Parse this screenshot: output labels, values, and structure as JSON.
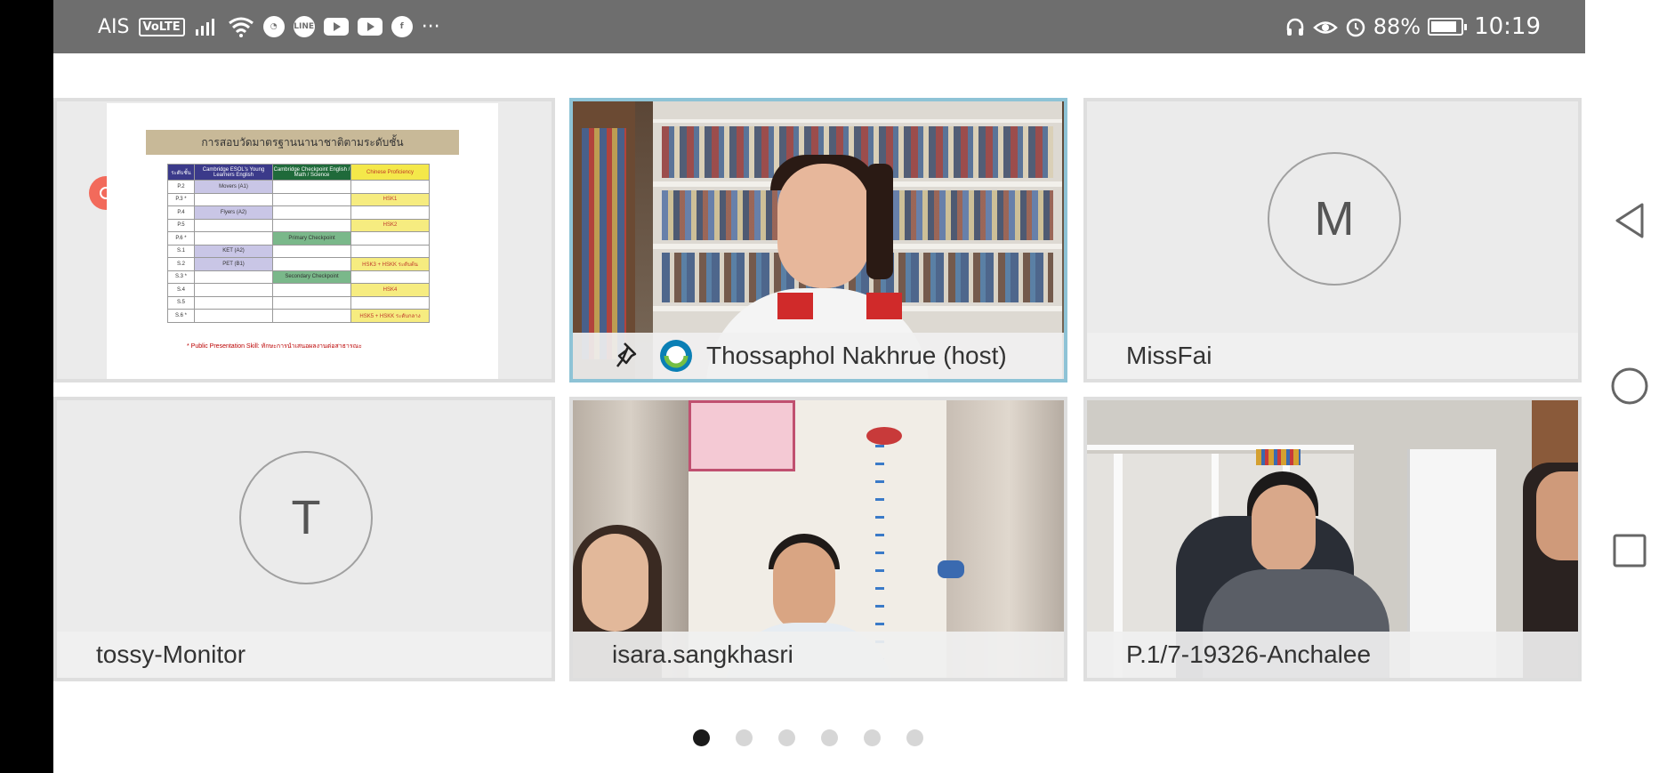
{
  "status_bar": {
    "carrier": "AIS",
    "volte": "VoLTE",
    "line_app": "LINE",
    "more": "···",
    "battery_pct": "88%",
    "battery_level": 0.88,
    "time": "10:19"
  },
  "slide": {
    "title": "การสอบวัดมาตรฐานนานาชาติตามระดับชั้น",
    "headers": [
      "ระดับชั้น",
      "Cambridge ESOL's Young Learners English",
      "Cambridge Checkpoint English / Math / Science",
      "Chinese Proficiency"
    ],
    "rows": [
      [
        "P.2",
        "Movers (A1)",
        "",
        ""
      ],
      [
        "P.3 *",
        "",
        "",
        "HSK1"
      ],
      [
        "P.4",
        "Flyers (A2)",
        "",
        ""
      ],
      [
        "P.5",
        "",
        "",
        "HSK2"
      ],
      [
        "P.6 *",
        "",
        "Primary Checkpoint",
        ""
      ],
      [
        "S.1",
        "KET (A2)",
        "",
        ""
      ],
      [
        "S.2",
        "PET (B1)",
        "",
        "HSK3 + HSKK ระดับต้น"
      ],
      [
        "S.3 *",
        "",
        "Secondary Checkpoint",
        ""
      ],
      [
        "S.4",
        "",
        "",
        "HSK4"
      ],
      [
        "S.5",
        "",
        "",
        ""
      ],
      [
        "S.6 *",
        "",
        "",
        "HSK5 + HSKK ระดับกลาง"
      ]
    ],
    "note": "* Public Presentation Skill: ทักษะการนำเสนอผลงานต่อสาธารณะ"
  },
  "participants": [
    {
      "name": "Thossaphol Nakhrue (host)",
      "host": true
    },
    {
      "name": "MissFai",
      "initial": "M"
    },
    {
      "name": "tossy-Monitor",
      "initial": "T"
    },
    {
      "name": "isara.sangkhasri"
    },
    {
      "name": "P.1/7-19326-Anchalee"
    }
  ],
  "pager": {
    "count": 6,
    "active": 0
  },
  "colors": {
    "status_bar": "#6e6e6e",
    "active_border": "#8ec3d6",
    "tile_bg": "#ebebeb",
    "record_dot": "#f26a5b"
  }
}
